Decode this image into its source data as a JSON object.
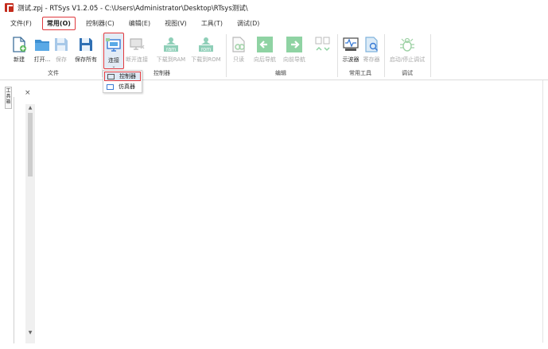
{
  "window": {
    "title": "测试.zpj - RTSys V1.2.05 - C:\\Users\\Administrator\\Desktop\\RTsys测试\\"
  },
  "menu": [
    {
      "label": "文件(F)",
      "active": false
    },
    {
      "label": "常用(O)",
      "active": true
    },
    {
      "label": "控制器(C)",
      "active": false
    },
    {
      "label": "编辑(E)",
      "active": false
    },
    {
      "label": "视图(V)",
      "active": false
    },
    {
      "label": "工具(T)",
      "active": false
    },
    {
      "label": "调试(D)",
      "active": false
    }
  ],
  "ribbon": {
    "groups": {
      "file": "文件",
      "controller": "控制器",
      "edit": "编辑",
      "tools": "常用工具",
      "debug": "调试"
    },
    "buttons": {
      "new": "新建",
      "open": "打开...",
      "save": "保存",
      "save_all": "保存所有",
      "connect": "连接",
      "disconnect": "断开连接",
      "download_ram": "下载到RAM",
      "download_rom": "下载到ROM",
      "find": "只读",
      "nav_back": "向后导航",
      "nav_forward": "向前导航",
      "oscilloscope": "示波器",
      "register": "寄存器",
      "start_stop_debug": "启动/停止调试"
    },
    "icon_text": {
      "ram": "ram",
      "rom": "rom"
    }
  },
  "dropdown": {
    "items": [
      {
        "label": "控制器"
      },
      {
        "label": "仿真器"
      }
    ]
  },
  "side_panel": {
    "tab_label": "工具箱"
  },
  "colors": {
    "highlight": "#e0393e",
    "accent_blue": "#3a7bd5",
    "green": "#5cb85c",
    "teal": "#4aa38c"
  }
}
